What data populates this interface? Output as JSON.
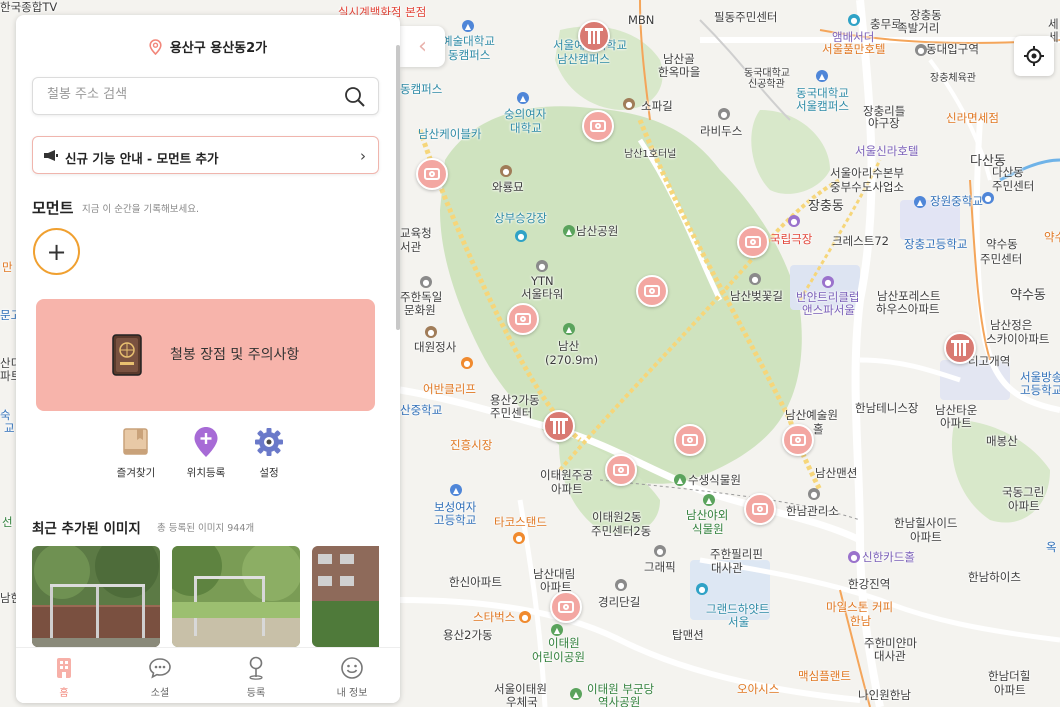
{
  "header": {
    "location": "용산구 용산동2가"
  },
  "search": {
    "placeholder": "철봉 주소 검색"
  },
  "notice": {
    "label": "신규 기능 안내 - 모먼트 추가"
  },
  "moment": {
    "title": "모먼트",
    "subtitle": "지금 이 순간을 기록해보세요.",
    "add_label": "+"
  },
  "banner": {
    "label": "철봉 장점 및 주의사항"
  },
  "quick_actions": [
    {
      "label": "즐겨찾기",
      "icon": "bookmark-icon"
    },
    {
      "label": "위치등록",
      "icon": "location-add-icon"
    },
    {
      "label": "설정",
      "icon": "gear-icon"
    }
  ],
  "recent": {
    "title": "최근 추가된 이미지",
    "subtitle": "총 등록된 이미지 944개"
  },
  "tabs": [
    {
      "label": "홈",
      "icon": "home-icon",
      "active": true
    },
    {
      "label": "소셜",
      "icon": "chat-icon",
      "active": false
    },
    {
      "label": "등록",
      "icon": "pin-icon",
      "active": false
    },
    {
      "label": "내 정보",
      "icon": "smile-icon",
      "active": false
    }
  ],
  "colors": {
    "accent": "#f2867a",
    "banner_bg": "#f7b4ab",
    "notice_border": "#f0b5ad",
    "add_border": "#f0a030",
    "park_green": "#cfe3bf"
  },
  "map_labels": {
    "l1": "실시계백화점 본점",
    "l2": "MBN",
    "l3": "필동주민센터",
    "l4": "충무로",
    "l5": "장충동",
    "l6": "족발거리",
    "l7": "예술대학교",
    "l8": "동캠퍼스",
    "l9": "서울예술대학교",
    "l10": "남산캠퍼스",
    "l11": "남산골",
    "l12": "한옥마을",
    "l13": "앰배서더",
    "l14": "서울풀만호텔",
    "l15": "동대입구역",
    "l16": "동국대학교",
    "l17": "신공학관",
    "l18": "동국대학교",
    "l19": "서울캠퍼스",
    "l20": "장충체육관",
    "l21": "동캠퍼스",
    "l22": "숭의여자",
    "l23": "대학교",
    "l24": "소파길",
    "l25": "라비두스",
    "l26": "장충리틀",
    "l27": "야구장",
    "l28": "신라면세점",
    "l29": "남산케이블카",
    "l30": "남산1호터널",
    "l31": "서울신라호텔",
    "l32": "다산동",
    "l33": "다산동",
    "l34": "주민센터",
    "l35": "와룡묘",
    "l36": "서울아리수본부",
    "l37": "중부수도사업소",
    "l38": "장충동",
    "l39": "장원중학교",
    "l40": "상부승강장",
    "l41": "남산공원",
    "l42": "국립극장",
    "l43": "크레스트72",
    "l44": "장충고등학교",
    "l45": "약수동",
    "l46": "주민센터",
    "l47": "교육청",
    "l48": "서관",
    "l49": "YTN",
    "l50": "서울타워",
    "l51": "남산벚꽃길",
    "l52": "반얀트리클럽",
    "l53": "앤스파서울",
    "l54": "남산포레스트",
    "l55": "하우스아파트",
    "l56": "약수동",
    "l57": "주한독일",
    "l58": "문화원",
    "l59": "남산",
    "l60": "(270.9m)",
    "l61": "남산정은",
    "l62": "스카이아파트",
    "l63": "대원정사",
    "l64": "티고개역",
    "l65": "어반클리프",
    "l66": "용산2가동",
    "l67": "주민센터",
    "l68": "산중학교",
    "l69": "남산예술원",
    "l70": "홀",
    "l71": "한남테니스장",
    "l72": "남산타운",
    "l73": "아파트",
    "l74": "서울방송",
    "l75": "고등학교",
    "l76": "진흥시장",
    "l77": "이태원주공",
    "l78": "아파트",
    "l79": "수생식물원",
    "l80": "남산맨션",
    "l81": "매봉산",
    "l82": "국동그린",
    "l83": "아파트",
    "l84": "보성여자",
    "l85": "고등학교",
    "l86": "타코스탠드",
    "l87": "이태원2동",
    "l88": "주민센터2동",
    "l89": "남산야외",
    "l90": "식물원",
    "l91": "한남관리소",
    "l92": "한남힐사이드",
    "l93": "아파트",
    "l94": "신한카드홀",
    "l95": "한신아파트",
    "l96": "남산대림",
    "l97": "아파트",
    "l98": "그래픽",
    "l99": "주한필리핀",
    "l100": "대사관",
    "l101": "한강진역",
    "l102": "한남하이츠",
    "l103": "경리단길",
    "l104": "그랜드하얏트",
    "l105": "서울",
    "l106": "마일스톤 커피",
    "l107": "한남",
    "l108": "스타벅스",
    "l109": "용산2가동",
    "l110": "이태원",
    "l111": "어린이공원",
    "l112": "탑맨션",
    "l113": "주한미얀마",
    "l114": "대사관",
    "l115": "맥심플랜트",
    "l116": "오아시스",
    "l117": "한남더힐",
    "l118": "아파트",
    "l119": "서울이태원",
    "l120": "우체국",
    "l121": "이태원 부군당",
    "l122": "역사공원",
    "l123": "나인원한남",
    "l124": "한국종합TV",
    "l125": "만",
    "l126": "문고",
    "l127": "산디",
    "l128": "파트",
    "l129": "숙",
    "l130": "교",
    "l131": "선",
    "l132": "남한",
    "l133": "약수",
    "l134": "옥",
    "l135": "세",
    "l136": "세",
    "l137": "장충체육관",
    "l138": "장충동"
  }
}
